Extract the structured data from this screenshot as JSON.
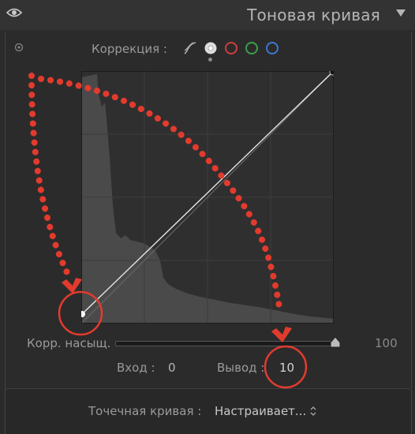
{
  "panel": {
    "title": "Тоновая кривая",
    "icons": {
      "visibility": "eye-icon",
      "collapse": "triangle-down-icon",
      "target": "target-adjust-icon"
    }
  },
  "correction": {
    "label": "Коррекция :",
    "channels": [
      {
        "name": "parametric",
        "icon": "parametric-curve-icon",
        "color": "#b0b0b0"
      },
      {
        "name": "rgb",
        "icon": "white-dot-icon",
        "color": "#dddddd",
        "selected": true
      },
      {
        "name": "red",
        "icon": "red-circle-icon",
        "color": "#d23c3c"
      },
      {
        "name": "green",
        "icon": "green-circle-icon",
        "color": "#3aa048"
      },
      {
        "name": "blue",
        "icon": "blue-circle-icon",
        "color": "#3c78d2"
      }
    ]
  },
  "curve": {
    "points_percent": [
      [
        3,
        4
      ],
      [
        100,
        100
      ]
    ],
    "highlighted_point": "black-point"
  },
  "saturation": {
    "label": "Корр. насыщ.",
    "value": "100",
    "level": 1.0
  },
  "readout": {
    "input_label": "Вход :",
    "input_value": "0",
    "output_label": "Вывод :",
    "output_value": "10"
  },
  "point_curve": {
    "label": "Точечная кривая :",
    "selected": "Настраивает..."
  },
  "colors": {
    "annotation_red": "#e23b2e",
    "graph_bg": "#2f2f2f",
    "histogram": "#4a4a4a"
  }
}
